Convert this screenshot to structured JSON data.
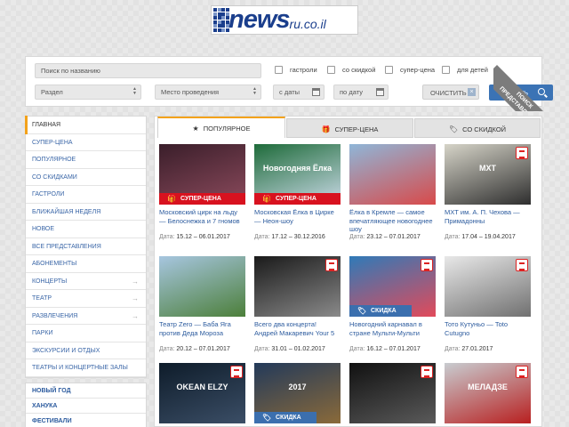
{
  "logo": {
    "word": "news",
    "domain": "ru.co.il"
  },
  "search": {
    "name_placeholder": "Поиск по названию",
    "section_placeholder": "Раздел",
    "venue_placeholder": "Место проведения",
    "date_from_placeholder": "с даты",
    "date_to_placeholder": "по дату",
    "checkboxes": [
      "гастроли",
      "со скидкой",
      "супер-цена",
      "для детей"
    ],
    "clear_label": "ОЧИСТИТЬ",
    "search_label": "ИСКАТЬ"
  },
  "ribbon": {
    "line1": "ПОИСК",
    "line2": "ПРЕДСТАВЛЕНИЙ"
  },
  "sidebar": {
    "items": [
      {
        "label": "ГЛАВНАЯ",
        "arrow": false
      },
      {
        "label": "СУПЕР-ЦЕНА",
        "arrow": false
      },
      {
        "label": "ПОПУЛЯРНОЕ",
        "arrow": false
      },
      {
        "label": "СО СКИДКАМИ",
        "arrow": false
      },
      {
        "label": "ГАСТРОЛИ",
        "arrow": false
      },
      {
        "label": "БЛИЖАЙШАЯ НЕДЕЛЯ",
        "arrow": false
      },
      {
        "label": "НОВОЕ",
        "arrow": false
      },
      {
        "label": "ВСЕ ПРЕДСТАВЛЕНИЯ",
        "arrow": false
      },
      {
        "label": "АБОНЕМЕНТЫ",
        "arrow": false
      },
      {
        "label": "КОНЦЕРТЫ",
        "arrow": true
      },
      {
        "label": "ТЕАТР",
        "arrow": true
      },
      {
        "label": "РАЗВЛЕЧЕНИЯ",
        "arrow": true
      },
      {
        "label": "ПАРКИ",
        "arrow": false
      },
      {
        "label": "ЭКСКУРСИИ И ОТДЫХ",
        "arrow": false
      },
      {
        "label": "ТЕАТРЫ И КОНЦЕРТНЫЕ ЗАЛЫ",
        "arrow": false
      }
    ],
    "special": [
      "НОВЫЙ ГОД",
      "ХАНУКА",
      "ФЕСТИВАЛИ"
    ]
  },
  "tabs": [
    {
      "label": "ПОПУЛЯРНОЕ",
      "icon": "star-icon",
      "glyph": "★"
    },
    {
      "label": "СУПЕР-ЦЕНА",
      "icon": "gift-icon",
      "glyph": "🎁"
    },
    {
      "label": "СО СКИДКОЙ",
      "icon": "tag-icon",
      "glyph": "🏷"
    }
  ],
  "date_label": "Дата:",
  "badges": {
    "super": "СУПЕР-ЦЕНА",
    "discount": "СКИДКА"
  },
  "cards": [
    {
      "title": "Московский цирк на льду — Белоснежка и 7 гномов",
      "date": "15.12 – 06.01.2017",
      "badge": "super",
      "ticket": false,
      "caption": "",
      "colors": [
        "#3a1e2a",
        "#8b4a5c"
      ]
    },
    {
      "title": "Московская Ёлка в Цирке — Неон-шоу",
      "date": "17.12 – 30.12.2016",
      "badge": "super",
      "ticket": false,
      "caption": "Новогодняя Ёлка",
      "colors": [
        "#1e6b3a",
        "#c9d9e6"
      ]
    },
    {
      "title": "Ёлка в Кремле — самое впечатляющее новогоднее шоу",
      "date": "23.12 – 07.01.2017",
      "badge": "",
      "ticket": false,
      "caption": "",
      "colors": [
        "#8fb6d8",
        "#d84a4a"
      ]
    },
    {
      "title": "МХТ им. А. П. Чехова — Примадонны",
      "date": "17.04 – 19.04.2017",
      "badge": "",
      "ticket": true,
      "caption": "МХТ",
      "colors": [
        "#d6d4c8",
        "#2e2e2e"
      ]
    },
    {
      "title": "Театр Zero — Баба Яга против Деда Мороза",
      "date": "20.12 – 07.01.2017",
      "badge": "",
      "ticket": false,
      "caption": "",
      "colors": [
        "#a7c6e0",
        "#4c7f3a"
      ]
    },
    {
      "title": "Всего два концерта! Андрей Макаревич Your 5",
      "date": "31.01 – 01.02.2017",
      "badge": "",
      "ticket": true,
      "caption": "",
      "colors": [
        "#1a1a1a",
        "#8a8a8a"
      ]
    },
    {
      "title": "Новогодний карнавал в стране Мульти-Мульти",
      "date": "16.12 – 07.01.2017",
      "badge": "discount",
      "ticket": true,
      "caption": "",
      "colors": [
        "#2f7ab8",
        "#e24a5a"
      ]
    },
    {
      "title": "Тото Кутуньо — Toto Cutugno",
      "date": "27.01.2017",
      "badge": "",
      "ticket": true,
      "caption": "",
      "colors": [
        "#e8e8e8",
        "#707070"
      ]
    },
    {
      "title": "",
      "date": "",
      "badge": "",
      "ticket": true,
      "caption": "OKEAN ELZY",
      "colors": [
        "#0e1c2a",
        "#3b4e66"
      ]
    },
    {
      "title": "",
      "date": "",
      "badge": "discount",
      "ticket": false,
      "caption": "2017",
      "colors": [
        "#233a5a",
        "#8a6a3a"
      ]
    },
    {
      "title": "",
      "date": "",
      "badge": "",
      "ticket": true,
      "caption": "",
      "colors": [
        "#111111",
        "#5a5a5a"
      ]
    },
    {
      "title": "",
      "date": "",
      "badge": "",
      "ticket": true,
      "caption": "МЕЛАДЗЕ",
      "colors": [
        "#c8ccd0",
        "#b82020"
      ]
    }
  ]
}
